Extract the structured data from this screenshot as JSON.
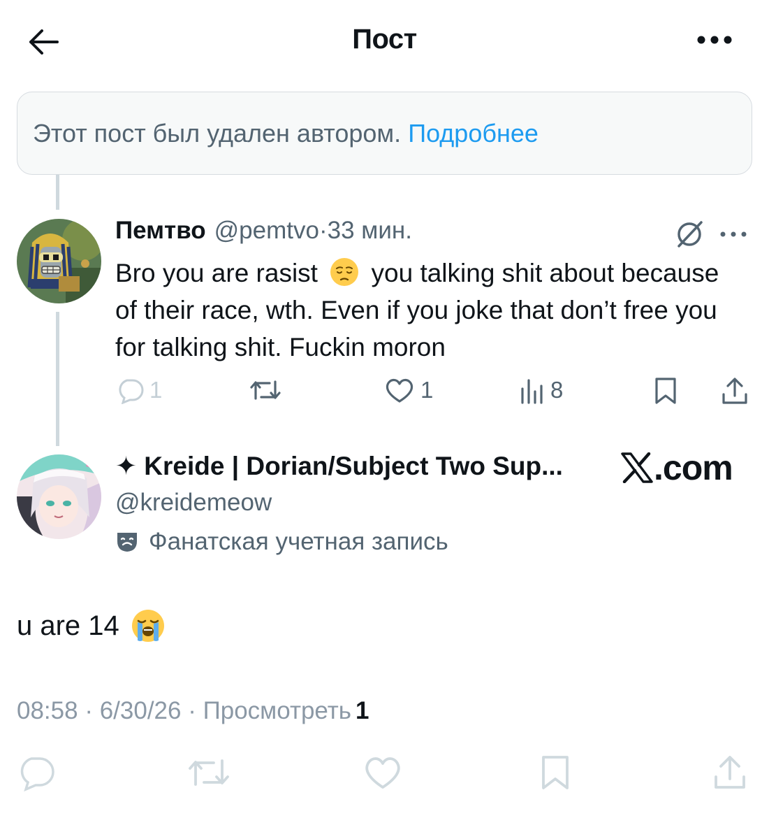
{
  "header": {
    "title": "Пост"
  },
  "deleted_notice": {
    "text": "Этот пост был удален автором.",
    "link": "Подробнее"
  },
  "reply": {
    "name": "Пемтво",
    "handle": "@pemtvo",
    "separator": " · ",
    "time": "33 мин.",
    "text_part1": "Bro you are rasist",
    "text_part2": "you talking shit about because of their race, wth. Even if you joke that don’t free you for talking shit. Fuckin moron",
    "emoji": "pensive-face",
    "stats": {
      "replies": "1",
      "likes": "1",
      "views": "8"
    }
  },
  "main_post": {
    "name": "✦ Kreide | Dorian/Subject Two Sup...",
    "handle": "@kreidemeow",
    "account_label": "Фанатская учетная запись",
    "text": "u are 14",
    "emoji": "loudly-crying-face",
    "time": "08:58",
    "date": "6/30/26",
    "views_label": "Просмотреть",
    "views": "1",
    "meta_sep": " · "
  },
  "watermark": {
    "text": ".com"
  },
  "colors": {
    "accent": "#1d9bf0",
    "secondary": "#536471",
    "muted": "#cfd9de"
  }
}
